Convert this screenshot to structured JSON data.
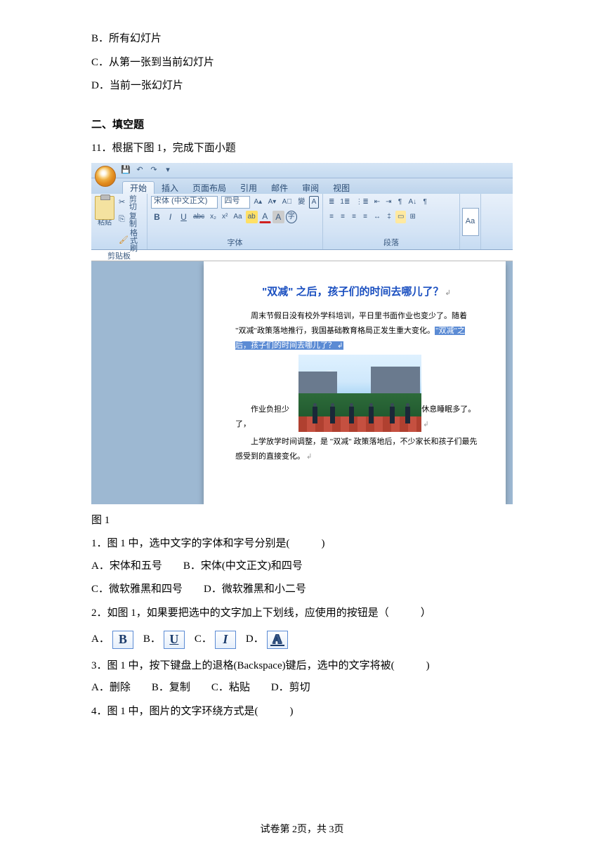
{
  "options_prev": {
    "b": "B．所有幻灯片",
    "c": "C．从第一张到当前幻灯片",
    "d": "D．当前一张幻灯片"
  },
  "section2": "二、填空题",
  "q11": "11．根据下图 1，完成下面小题",
  "word": {
    "qat": {
      "save": "💾",
      "undo": "↶",
      "redo": "↷",
      "down": "▾"
    },
    "tabs": [
      "开始",
      "插入",
      "页面布局",
      "引用",
      "邮件",
      "审阅",
      "视图"
    ],
    "clipboard": {
      "paste": "粘贴",
      "cut": "剪切",
      "copy": "复制",
      "brush": "格式刷",
      "label": "剪贴板"
    },
    "font": {
      "name": "宋体 (中文正文)",
      "size": "四号",
      "label": "字体"
    },
    "para_label": "段落",
    "styles_hint": "Aa",
    "doc": {
      "title": "\"双减\" 之后，孩子们的时间去哪儿了？",
      "p1a": "周末节假日没有校外学科培训，平日里书面作业也变少了。随着",
      "p1b": "\"双减\"政策落地推行，我国基础教育格局正发生重大变化。",
      "hl": "\"双减\"之后，孩子们的时间去哪儿了？",
      "left": "作业负担少了，",
      "right": "休息睡眠多了。",
      "p3": "上学放学时间调整，是 \"双减\" 政策落地后，不少家长和孩子们最先感受到的直接变化。"
    }
  },
  "caption_fig1": "图 1",
  "sub": {
    "q1": "1．图 1 中，选中文字的字体和字号分别是(　　　)",
    "q1a": "A．宋体和五号　　B．宋体(中文正文)和四号",
    "q1c": "C．微软雅黑和四号　　D．微软雅黑和小二号",
    "q2": "2．如图 1，如果要把选中的文字加上下划线，应使用的按钮是（　　　）",
    "opt_a": "A．",
    "opt_b": "B．",
    "opt_c": "C．",
    "opt_d": "D．",
    "icon_b": "B",
    "icon_u": "U",
    "icon_i": "I",
    "icon_a": "A",
    "q3": "3．图 1 中，按下键盘上的退格(Backspace)键后，选中的文字将被(　　　)",
    "q3opts": "A．删除　　B．复制　　C．粘贴　　D．剪切",
    "q4": "4．图 1 中，图片的文字环绕方式是(　　　)"
  },
  "footer": "试卷第 2页，共 3页"
}
